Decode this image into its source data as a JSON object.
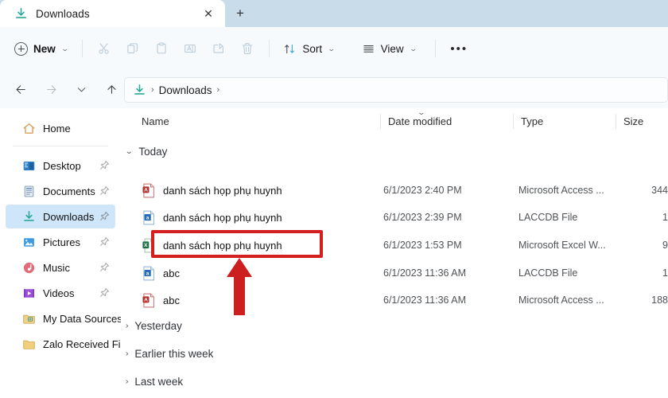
{
  "window": {
    "tab": {
      "title": "Downloads",
      "icon": "downloads-icon",
      "close_label": "✕"
    },
    "new_tab_label": "+"
  },
  "toolbar": {
    "new_label": "New",
    "new_chevron": "⌄",
    "cut_label": "Cut",
    "copy_label": "Copy",
    "paste_label": "Paste",
    "rename_label": "Rename",
    "share_label": "Share",
    "delete_label": "Delete",
    "sort_label": "Sort",
    "sort_chevron": "⌄",
    "view_label": "View",
    "view_chevron": "⌄",
    "more_label": "•••"
  },
  "address": {
    "back_label": "←",
    "forward_label": "→",
    "recent_label": "⌄",
    "up_label": "↑",
    "breadcrumb_icon": "downloads-icon",
    "breadcrumb_sep1": "›",
    "breadcrumb_text": "Downloads",
    "breadcrumb_sep2": "›"
  },
  "sidebar": {
    "items": [
      {
        "label": "Home",
        "icon": "home-icon",
        "pinned": false,
        "selected": false
      },
      {
        "label": "Desktop",
        "icon": "desktop-icon",
        "pinned": true,
        "selected": false
      },
      {
        "label": "Documents",
        "icon": "documents-icon",
        "pinned": true,
        "selected": false
      },
      {
        "label": "Downloads",
        "icon": "downloads-icon",
        "pinned": true,
        "selected": true
      },
      {
        "label": "Pictures",
        "icon": "pictures-icon",
        "pinned": true,
        "selected": false
      },
      {
        "label": "Music",
        "icon": "music-icon",
        "pinned": true,
        "selected": false
      },
      {
        "label": "Videos",
        "icon": "videos-icon",
        "pinned": true,
        "selected": false
      },
      {
        "label": "My Data Sources",
        "icon": "data-folder-icon",
        "pinned": false,
        "selected": false
      },
      {
        "label": "Zalo Received Files",
        "icon": "folder-icon",
        "pinned": false,
        "selected": false
      }
    ]
  },
  "columns": {
    "name": "Name",
    "date_modified": "Date modified",
    "type": "Type",
    "size": "Size",
    "sort_indicator": "⌄"
  },
  "groups": [
    {
      "label": "Today",
      "expanded": true,
      "chevron": "⌄"
    },
    {
      "label": "Yesterday",
      "expanded": false,
      "chevron": "›"
    },
    {
      "label": "Earlier this week",
      "expanded": false,
      "chevron": "›"
    },
    {
      "label": "Last week",
      "expanded": false,
      "chevron": "›"
    }
  ],
  "files": [
    {
      "name": "danh sách họp phụ huynh",
      "date": "6/1/2023 2:40 PM",
      "type": "Microsoft Access ...",
      "size": "344",
      "icon": "access-file-icon"
    },
    {
      "name": "danh sách họp phụ huynh",
      "date": "6/1/2023 2:39 PM",
      "type": "LACCDB File",
      "size": "1",
      "icon": "laccdb-file-icon"
    },
    {
      "name": "danh sách họp phụ huynh",
      "date": "6/1/2023 1:53 PM",
      "type": "Microsoft Excel W...",
      "size": "9",
      "icon": "excel-file-icon"
    },
    {
      "name": "abc",
      "date": "6/1/2023 11:36 AM",
      "type": "LACCDB File",
      "size": "1",
      "icon": "laccdb-file-icon"
    },
    {
      "name": "abc",
      "date": "6/1/2023 11:36 AM",
      "type": "Microsoft Access ...",
      "size": "188",
      "icon": "access-file-icon"
    }
  ],
  "annotation": {
    "highlight_color": "#d31f1f",
    "arrow_color": "#cc1f1f",
    "highlighted_row_index": 2
  },
  "colors": {
    "tabstrip_bg": "#c9dcea",
    "toolbar_bg": "#f7fafd",
    "selection_bg": "#cfe6fa",
    "accent_green": "#2aa99a",
    "excel_green": "#1e7145",
    "access_red": "#b5302b",
    "laccdb_blue": "#2a6ebb"
  }
}
